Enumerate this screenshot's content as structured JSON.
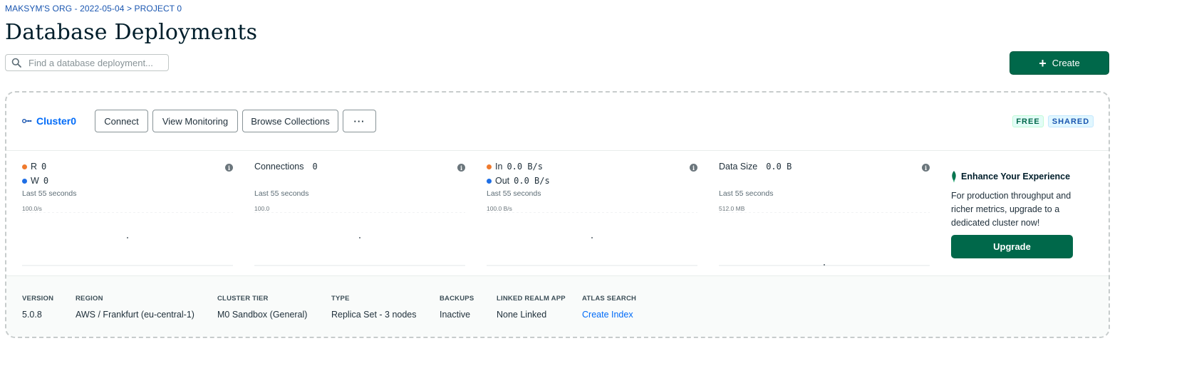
{
  "breadcrumb": {
    "org": "MAKSYM'S ORG - 2022-05-04",
    "separator": ">",
    "project": "PROJECT 0"
  },
  "page_title": "Database Deployments",
  "search": {
    "placeholder": "Find a database deployment...",
    "value": ""
  },
  "create_button": {
    "label": "Create",
    "icon": "plus-icon"
  },
  "cluster": {
    "name": "Cluster0",
    "buttons": {
      "connect": "Connect",
      "view_monitoring": "View Monitoring",
      "browse_collections": "Browse Collections",
      "more": "···"
    },
    "badges": {
      "free": "FREE",
      "shared": "SHARED"
    }
  },
  "metrics": {
    "ops": {
      "read_label": "R",
      "read_value": "0",
      "write_label": "W",
      "write_value": "0",
      "window": "Last 55 seconds",
      "scale": "100.0/s"
    },
    "connections": {
      "label": "Connections",
      "value": "0",
      "window": "Last 55 seconds",
      "scale": "100.0"
    },
    "network": {
      "in_label": "In",
      "in_value": "0.0 B/s",
      "out_label": "Out",
      "out_value": "0.0 B/s",
      "window": "Last 55 seconds",
      "scale": "100.0 B/s"
    },
    "data_size": {
      "label": "Data Size",
      "value": "0.0 B",
      "window": "Last 55 seconds",
      "scale": "512.0 MB"
    }
  },
  "upsell": {
    "title": "Enhance Your Experience",
    "text": "For production throughput and richer metrics, upgrade to a dedicated cluster now!",
    "button": "Upgrade"
  },
  "details": {
    "version": {
      "label": "VERSION",
      "value": "5.0.8"
    },
    "region": {
      "label": "REGION",
      "value": "AWS / Frankfurt (eu-central-1)"
    },
    "tier": {
      "label": "CLUSTER TIER",
      "value": "M0 Sandbox (General)"
    },
    "type": {
      "label": "TYPE",
      "value": "Replica Set - 3 nodes"
    },
    "backups": {
      "label": "BACKUPS",
      "value": "Inactive"
    },
    "realm": {
      "label": "LINKED REALM APP",
      "value": "None Linked"
    },
    "atlas_search": {
      "label": "ATLAS SEARCH",
      "value": "Create Index"
    }
  },
  "colors": {
    "brand_green": "#00684a",
    "link_blue": "#016bf8",
    "read_dot": "#ef7a2e",
    "write_dot": "#1f6fe5"
  }
}
